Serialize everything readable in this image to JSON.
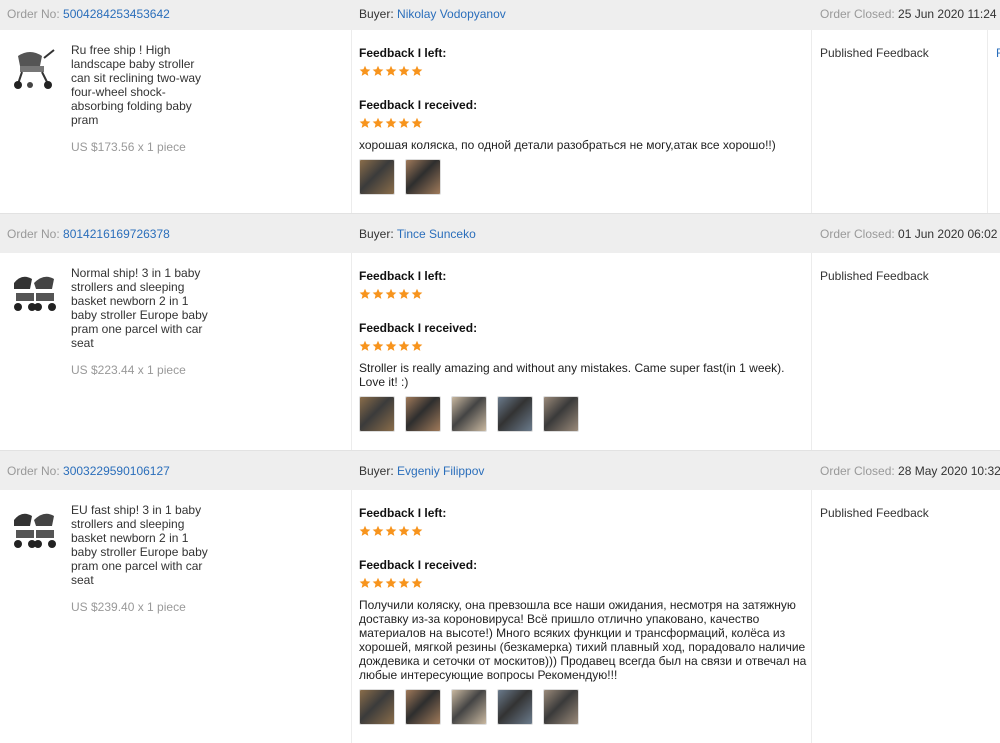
{
  "labels": {
    "order_no": "Order No:",
    "buyer": "Buyer:",
    "order_closed": "Order Closed:",
    "feedback_left": "Feedback I left:",
    "feedback_received": "Feedback I received:"
  },
  "colors": {
    "link": "#2a6ebb",
    "star": "#f7941d",
    "header_bg": "#eeeeee"
  },
  "orders": [
    {
      "order_no": "5004284253453642",
      "buyer": "Nikolay Vodopyanov",
      "closed": "25 Jun 2020 11:24",
      "product_title": "Ru free ship ! High landscape baby stroller can sit reclining two-way four-wheel shock-absorbing folding baby pram",
      "price": "US $173.56 x 1 piece",
      "left_rating": 5,
      "received_rating": 5,
      "comment": "хорошая коляска, по одной детали разобраться не могу,атак все хорошо!!)",
      "photos": 2,
      "status": "Published Feedback",
      "edge_text": "F"
    },
    {
      "order_no": "8014216169726378",
      "buyer": "Tince Sunceko",
      "closed": "01 Jun 2020 06:02",
      "product_title": "Normal ship! 3 in 1 baby strollers and sleeping basket newborn 2 in 1 baby stroller Europe baby pram one parcel with car seat",
      "price": "US $223.44 x 1 piece",
      "left_rating": 5,
      "received_rating": 5,
      "comment": "Stroller is really amazing and without any mistakes. Came super fast(in 1 week). Love it! :)",
      "photos": 5,
      "status": "Published Feedback",
      "edge_text": ""
    },
    {
      "order_no": "3003229590106127",
      "buyer": "Evgeniy Filippov",
      "closed": "28 May 2020 10:32",
      "product_title": "EU fast ship! 3 in 1 baby strollers and sleeping basket newborn 2 in 1 baby stroller Europe baby pram one parcel with car seat",
      "price": "US $239.40 x 1 piece",
      "left_rating": 5,
      "received_rating": 5,
      "comment": "Получили коляску, она превзошла все наши ожидания, несмотря на затяжную доставку из-за короновируса! Всё пришло отлично упаковано, качество материалов на высоте!) Много всяких функции и трансформаций, колёса из хорошей, мягкой резины (безкамерка) тихий плавный ход, порадовало наличие дождевика и сеточки от москитов))) Продавец всегда был на связи и отвечал на любые интересующие вопросы Рекомендую!!!",
      "photos": 5,
      "status": "Published Feedback",
      "edge_text": ""
    }
  ]
}
